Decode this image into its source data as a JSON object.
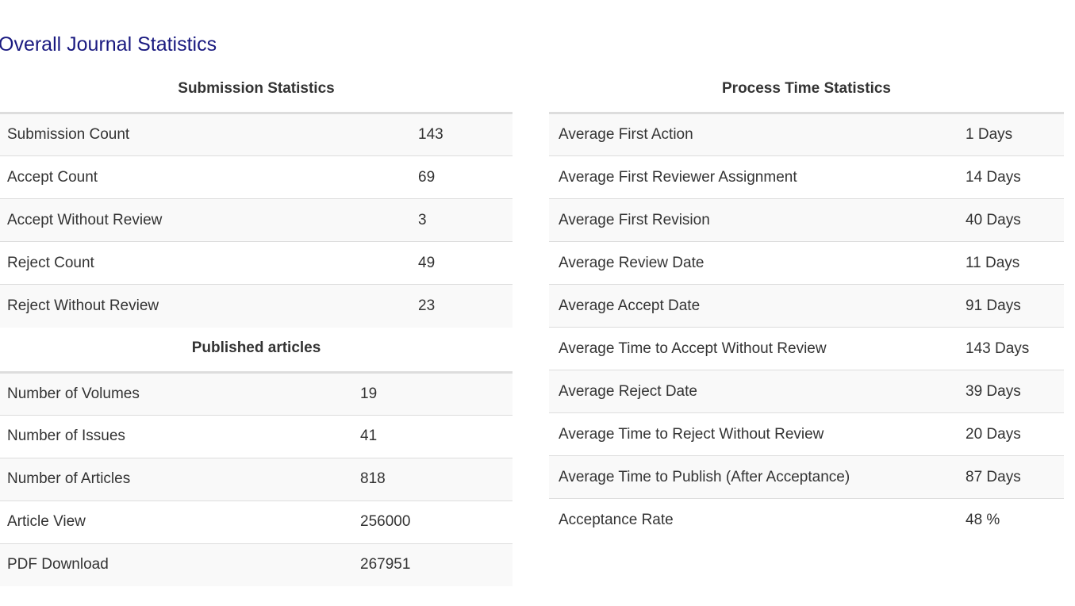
{
  "page": {
    "title": "Overall Journal Statistics"
  },
  "submission": {
    "caption": "Submission Statistics",
    "rows": [
      {
        "label": "Submission Count",
        "value": "143"
      },
      {
        "label": "Accept Count",
        "value": "69"
      },
      {
        "label": "Accept Without Review",
        "value": "3"
      },
      {
        "label": "Reject Count",
        "value": "49"
      },
      {
        "label": "Reject Without Review",
        "value": "23"
      }
    ]
  },
  "published": {
    "caption": "Published articles",
    "rows": [
      {
        "label": "Number of Volumes",
        "value": "19"
      },
      {
        "label": "Number of Issues",
        "value": "41"
      },
      {
        "label": "Number of Articles",
        "value": "818"
      },
      {
        "label": "Article View",
        "value": "256000"
      },
      {
        "label": "PDF Download",
        "value": "267951"
      }
    ]
  },
  "process": {
    "caption": "Process Time Statistics",
    "rows": [
      {
        "label": "Average First Action",
        "value": "1 Days"
      },
      {
        "label": "Average First Reviewer Assignment",
        "value": "14 Days"
      },
      {
        "label": "Average First Revision",
        "value": "40 Days"
      },
      {
        "label": "Average Review Date",
        "value": "11 Days"
      },
      {
        "label": "Average Accept Date",
        "value": "91 Days"
      },
      {
        "label": "Average Time to Accept Without Review",
        "value": "143 Days"
      },
      {
        "label": "Average Reject Date",
        "value": "39 Days"
      },
      {
        "label": "Average Time to Reject Without Review",
        "value": "20 Days"
      },
      {
        "label": "Average Time to Publish (After Acceptance)",
        "value": "87 Days"
      },
      {
        "label": "Acceptance Rate",
        "value": "48 %"
      }
    ]
  }
}
